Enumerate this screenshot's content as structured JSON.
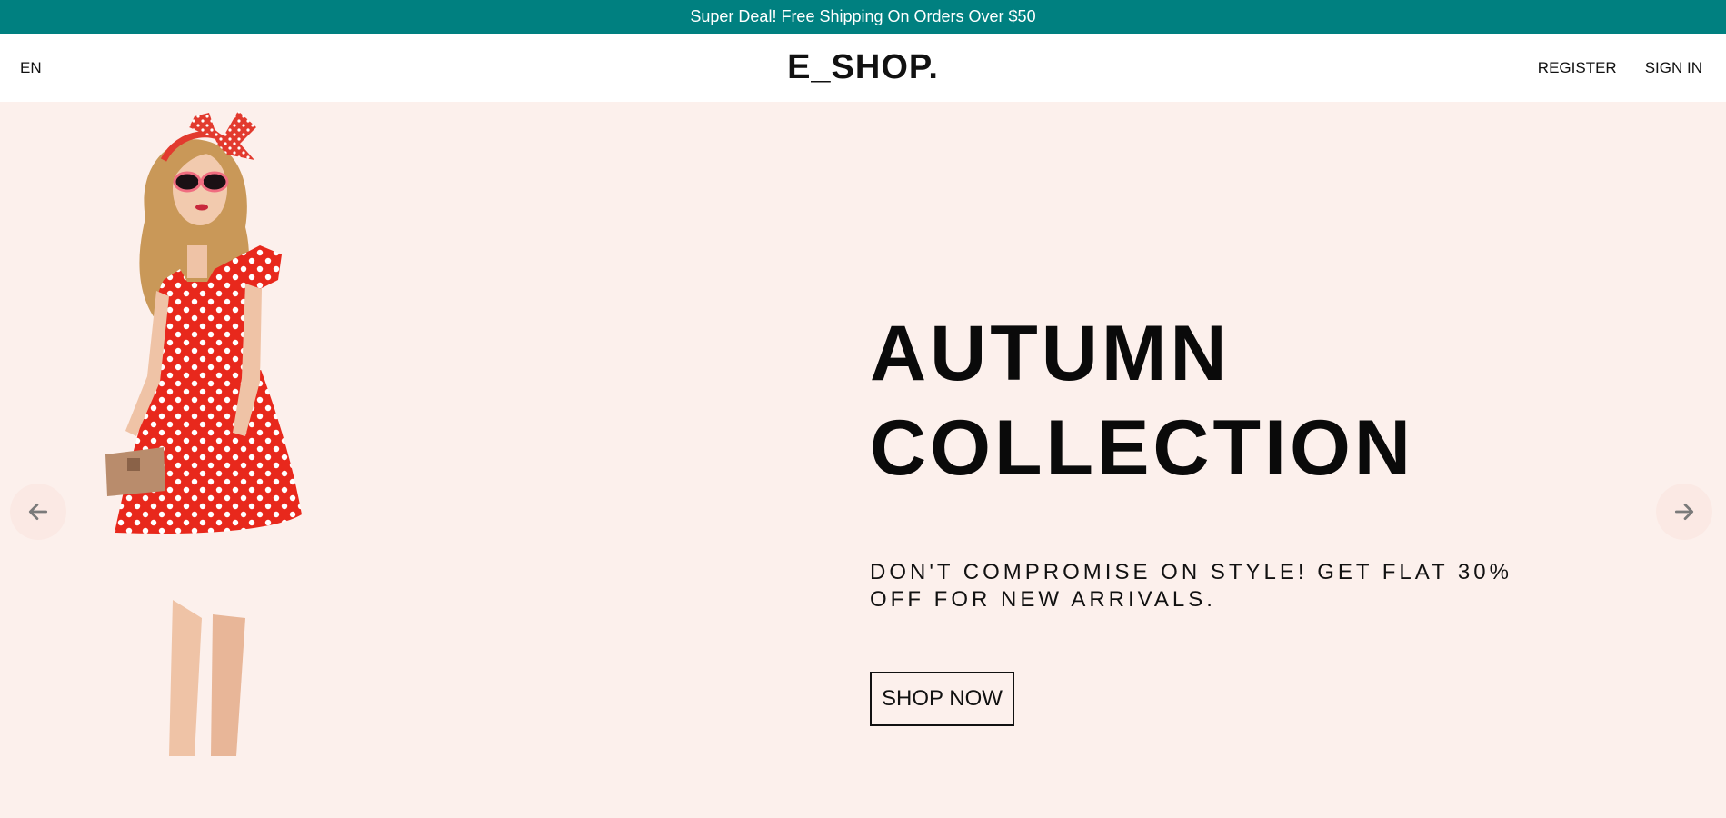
{
  "announcement": {
    "text": "Super Deal! Free Shipping On Orders Over $50"
  },
  "navbar": {
    "language": "EN",
    "logo": "E_SHOP.",
    "register_label": "REGISTER",
    "signin_label": "SIGN IN"
  },
  "slider": {
    "title_line1": "AUTUMN",
    "title_line2": "COLLECTION",
    "description": "DON'T COMPROMISE ON STYLE! GET FLAT 30% OFF FOR NEW ARRIVALS.",
    "button_label": "SHOP NOW",
    "prev_icon": "arrow-left-icon",
    "next_icon": "arrow-right-icon"
  },
  "colors": {
    "announcement_bg": "#008080",
    "slider_bg": "#fcf0ec",
    "arrow_bg": "#fbe9e4",
    "dress": "#e8281c"
  }
}
